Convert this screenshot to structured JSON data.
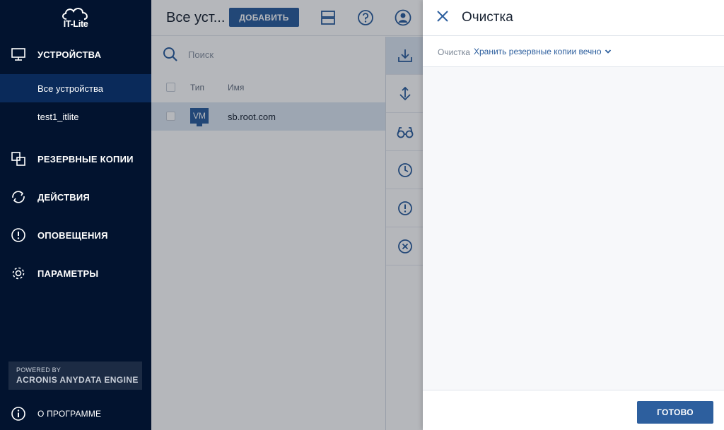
{
  "app": {
    "logo_text": "IT-Lite"
  },
  "sidebar": {
    "items": [
      {
        "label": "УСТРОЙСТВА",
        "icon": "monitor-icon"
      },
      {
        "label": "РЕЗЕРВНЫЕ КОПИИ",
        "icon": "copies-icon"
      },
      {
        "label": "ДЕЙСТВИЯ",
        "icon": "sync-icon"
      },
      {
        "label": "ОПОВЕЩЕНИЯ",
        "icon": "alert-icon"
      },
      {
        "label": "ПАРАМЕТРЫ",
        "icon": "gear-icon"
      }
    ],
    "subitems": [
      {
        "label": "Все устройства",
        "active": true
      },
      {
        "label": "test1_itlite",
        "active": false
      }
    ],
    "powered": {
      "line1": "POWERED BY",
      "line2": "ACRONIS ANYDATA ENGINE"
    },
    "about": {
      "label": "О ПРОГРАММЕ",
      "icon": "info-icon"
    }
  },
  "main": {
    "title": "Все уст...",
    "add_label": "ДОБАВИТЬ",
    "search": {
      "placeholder": "Поиск"
    },
    "table": {
      "columns": [
        "Тип",
        "Имя"
      ],
      "rows": [
        {
          "type": "VM",
          "name": "sb.root.com"
        }
      ]
    },
    "toolbar_icons": [
      "download-icon",
      "recover-icon",
      "glasses-icon",
      "clock-icon",
      "exclamation-icon",
      "cancel-icon"
    ]
  },
  "panel": {
    "title": "Очистка",
    "cleanup_label": "Очистка",
    "cleanup_value": "Хранить резервные копии вечно",
    "done_label": "ГОТОВО"
  },
  "colors": {
    "sidebar_bg": "#02132f",
    "sidebar_active": "#0a2a5a",
    "accent": "#2d5f9e",
    "link": "#2d5f9e",
    "overlay": "rgba(10,18,30,0.30)"
  }
}
